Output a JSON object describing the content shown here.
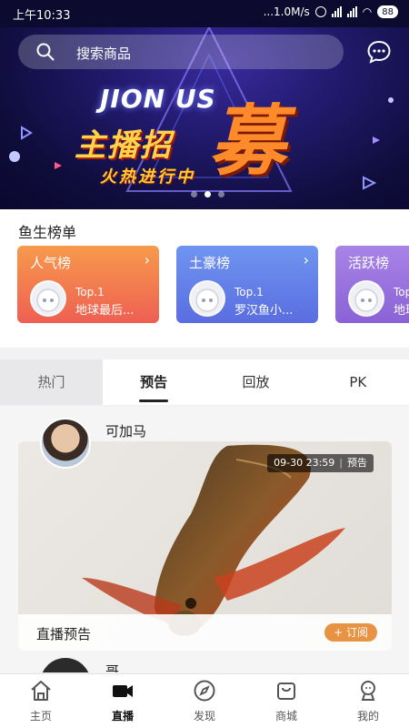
{
  "status_bar": {
    "time": "上午10:33",
    "speed": "...1.0M/s",
    "battery": "88"
  },
  "search": {
    "placeholder": "搜索商品"
  },
  "banner": {
    "line1": "JION US",
    "line2": "主播招",
    "line3": "募",
    "line4": "火热进行中",
    "dots": 3,
    "active_dot": 1
  },
  "ranking": {
    "title": "鱼生榜单",
    "cards": [
      {
        "title": "人气榜",
        "rank": "Top.1",
        "name": "地球最后..."
      },
      {
        "title": "土豪榜",
        "rank": "Top.1",
        "name": "罗汉鱼小..."
      },
      {
        "title": "活跃榜",
        "rank": "Top",
        "name": "地球"
      }
    ]
  },
  "tabs": [
    "热门",
    "预告",
    "回放",
    "PK"
  ],
  "active_tab": 1,
  "feed": {
    "host_name": "可加马",
    "time": "09-30 23:59",
    "badge": "预告",
    "footer_label": "直播预告",
    "subscribe_label": "+ 订阅",
    "next_host_name": "哥"
  },
  "nav": {
    "items": [
      "主页",
      "直播",
      "发现",
      "商城",
      "我的"
    ],
    "active": 1
  }
}
